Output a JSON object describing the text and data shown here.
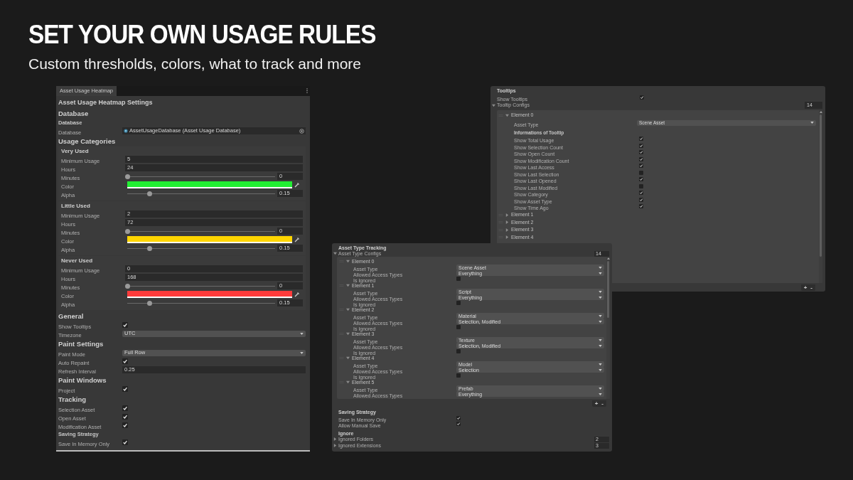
{
  "headline": "SET YOUR OWN USAGE RULES",
  "subtitle": "Custom thresholds, colors, what to track and more",
  "settings_window": {
    "tab": "Asset Usage Heatmap",
    "title": "Asset Usage Heatmap Settings",
    "rows": [
      {
        "kind": "heading",
        "text": "Database"
      },
      {
        "kind": "subheading",
        "text": "Database"
      },
      {
        "kind": "object",
        "label": "Database",
        "value": "AssetUsageDatabase (Asset Usage Database)"
      },
      {
        "kind": "heading",
        "text": "Usage Categories"
      },
      {
        "kind": "group",
        "title": "Very Used",
        "rows": [
          {
            "kind": "number",
            "label": "Minimum Usage",
            "value": "5"
          },
          {
            "kind": "number",
            "label": "Hours",
            "value": "24"
          },
          {
            "kind": "slider",
            "label": "Minutes",
            "level": 0,
            "value": "0"
          },
          {
            "kind": "color",
            "label": "Color",
            "color": "#22ee33"
          },
          {
            "kind": "slider",
            "label": "Alpha",
            "level": 0.15,
            "value": "0.15"
          }
        ]
      },
      {
        "kind": "group",
        "title": "Little Used",
        "rows": [
          {
            "kind": "number",
            "label": "Minimum Usage",
            "value": "2"
          },
          {
            "kind": "number",
            "label": "Hours",
            "value": "72"
          },
          {
            "kind": "slider",
            "label": "Minutes",
            "level": 0,
            "value": "0"
          },
          {
            "kind": "color",
            "label": "Color",
            "color": "#ffd600"
          },
          {
            "kind": "slider",
            "label": "Alpha",
            "level": 0.15,
            "value": "0.15"
          }
        ]
      },
      {
        "kind": "group",
        "title": "Never Used",
        "rows": [
          {
            "kind": "number",
            "label": "Minimum Usage",
            "value": "0"
          },
          {
            "kind": "number",
            "label": "Hours",
            "value": "168"
          },
          {
            "kind": "slider",
            "label": "Minutes",
            "level": 0,
            "value": "0"
          },
          {
            "kind": "color",
            "label": "Color",
            "color": "#ff3b3b"
          },
          {
            "kind": "slider",
            "label": "Alpha",
            "level": 0.15,
            "value": "0.15"
          }
        ]
      },
      {
        "kind": "heading",
        "text": "General"
      },
      {
        "kind": "checkbox",
        "label": "Show Tooltips",
        "checked": true
      },
      {
        "kind": "dropdown",
        "label": "Timezone",
        "value": "UTC"
      },
      {
        "kind": "heading",
        "text": "Paint Settings"
      },
      {
        "kind": "dropdown",
        "label": "Paint Mode",
        "value": "Full Row"
      },
      {
        "kind": "checkbox",
        "label": "Auto Repaint",
        "checked": true
      },
      {
        "kind": "number",
        "label": "Refresh Interval",
        "value": "0.25"
      },
      {
        "kind": "heading",
        "text": "Paint Windows"
      },
      {
        "kind": "checkbox",
        "label": "Project",
        "checked": true
      },
      {
        "kind": "heading",
        "text": "Tracking"
      },
      {
        "kind": "checkbox",
        "label": "Selection Asset",
        "checked": true
      },
      {
        "kind": "checkbox",
        "label": "Open Asset",
        "checked": true
      },
      {
        "kind": "checkbox",
        "label": "Modification Asset",
        "checked": true
      },
      {
        "kind": "subheading",
        "text": "Saving Strategy"
      },
      {
        "kind": "checkbox",
        "label": "Save In Memory Only",
        "checked": true
      }
    ]
  },
  "tooltips_panel": {
    "title": "Tooltips",
    "show_tooltips": {
      "label": "Show Tooltips",
      "checked": true
    },
    "configs": {
      "label": "Tooltip Configs",
      "expanded": true,
      "count": "14",
      "buttons": [
        "+",
        "-"
      ],
      "elements": [
        {
          "label": "Element 0",
          "expanded": true,
          "asset_type": {
            "label": "Asset Type",
            "value": "Scene Asset"
          },
          "info_title": "Informations of Tooltip",
          "options": [
            {
              "label": "Show Total Usage",
              "checked": true
            },
            {
              "label": "Show Selection Count",
              "checked": true
            },
            {
              "label": "Show Open Count",
              "checked": true
            },
            {
              "label": "Show Modification Count",
              "checked": true
            },
            {
              "label": "Show Last Access",
              "checked": true
            },
            {
              "label": "Show Last Selection",
              "checked": false
            },
            {
              "label": "Show Last Opened",
              "checked": true
            },
            {
              "label": "Show Last Modified",
              "checked": false
            },
            {
              "label": "Show Category",
              "checked": true
            },
            {
              "label": "Show Asset Type",
              "checked": true
            },
            {
              "label": "Show Time Ago",
              "checked": true
            }
          ]
        },
        {
          "label": "Element 1",
          "expanded": false
        },
        {
          "label": "Element 2",
          "expanded": false
        },
        {
          "label": "Element 3",
          "expanded": false
        },
        {
          "label": "Element 4",
          "expanded": false
        }
      ]
    }
  },
  "asset_type_panel": {
    "title": "Asset Type Tracking",
    "configs": {
      "label": "Asset Type Configs",
      "expanded": true,
      "count": "14",
      "buttons": [
        "+",
        "-"
      ],
      "elements": [
        {
          "label": "Element 0",
          "expanded": true,
          "fields": [
            {
              "kind": "dropdown",
              "label": "Asset Type",
              "value": "Scene Asset"
            },
            {
              "kind": "dropdown",
              "label": "Allowed Access Types",
              "value": "Everything"
            },
            {
              "kind": "checkbox",
              "label": "Is Ignored",
              "checked": false
            }
          ]
        },
        {
          "label": "Element 1",
          "expanded": true,
          "fields": [
            {
              "kind": "dropdown",
              "label": "Asset Type",
              "value": "Script"
            },
            {
              "kind": "dropdown",
              "label": "Allowed Access Types",
              "value": "Everything"
            },
            {
              "kind": "checkbox",
              "label": "Is Ignored",
              "checked": false
            }
          ]
        },
        {
          "label": "Element 2",
          "expanded": true,
          "fields": [
            {
              "kind": "dropdown",
              "label": "Asset Type",
              "value": "Material"
            },
            {
              "kind": "dropdown",
              "label": "Allowed Access Types",
              "value": "Selection, Modified"
            },
            {
              "kind": "checkbox",
              "label": "Is Ignored",
              "checked": false
            }
          ]
        },
        {
          "label": "Element 3",
          "expanded": true,
          "fields": [
            {
              "kind": "dropdown",
              "label": "Asset Type",
              "value": "Texture"
            },
            {
              "kind": "dropdown",
              "label": "Allowed Access Types",
              "value": "Selection, Modified"
            },
            {
              "kind": "checkbox",
              "label": "Is Ignored",
              "checked": false
            }
          ]
        },
        {
          "label": "Element 4",
          "expanded": true,
          "fields": [
            {
              "kind": "dropdown",
              "label": "Asset Type",
              "value": "Model"
            },
            {
              "kind": "dropdown",
              "label": "Allowed Access Types",
              "value": "Selection"
            },
            {
              "kind": "checkbox",
              "label": "Is Ignored",
              "checked": false
            }
          ]
        },
        {
          "label": "Element 5",
          "expanded": true,
          "fields": [
            {
              "kind": "dropdown",
              "label": "Asset Type",
              "value": "Prefab"
            },
            {
              "kind": "dropdown",
              "label": "Allowed Access Types",
              "value": "Everything"
            }
          ]
        }
      ]
    },
    "saving": {
      "title": "Saving Strategy",
      "options": [
        {
          "label": "Save In Memory Only",
          "checked": true
        },
        {
          "label": "Allow Manual Save",
          "checked": true
        }
      ]
    },
    "ignore": {
      "title": "Ignore",
      "lists": [
        {
          "label": "Ignored Folders",
          "expanded": false,
          "count": "2"
        },
        {
          "label": "Ignored Extensions",
          "expanded": false,
          "count": "3"
        }
      ]
    }
  }
}
